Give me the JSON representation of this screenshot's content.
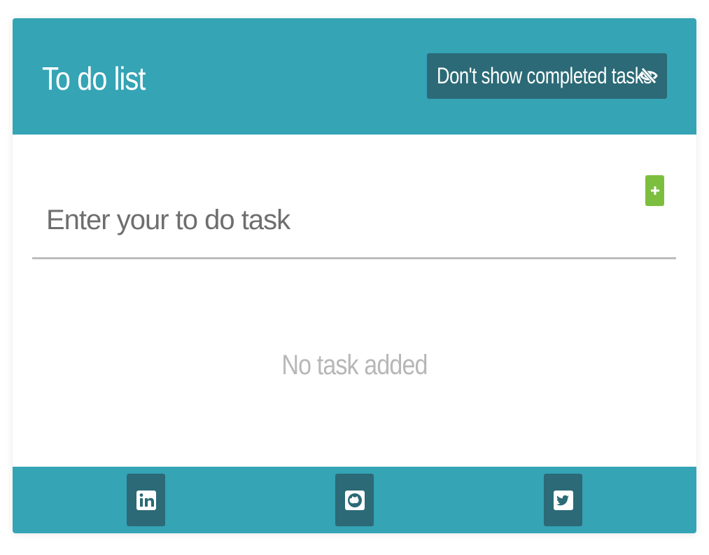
{
  "colors": {
    "accent": "#35a4b5",
    "dark": "#2b6a76",
    "green": "#7cbf3f",
    "empty_text": "#b7b7b7"
  },
  "header": {
    "title": "To do list",
    "toggle_label": "Don't show completed tasks",
    "toggle_icon": "eye-slash-icon"
  },
  "input": {
    "placeholder": "Enter your to do task",
    "value": "",
    "add_icon": "plus-icon"
  },
  "list": {
    "empty_message": "No task added"
  },
  "footer": {
    "links": [
      {
        "icon": "linkedin-icon"
      },
      {
        "icon": "github-icon"
      },
      {
        "icon": "twitter-icon"
      }
    ]
  }
}
